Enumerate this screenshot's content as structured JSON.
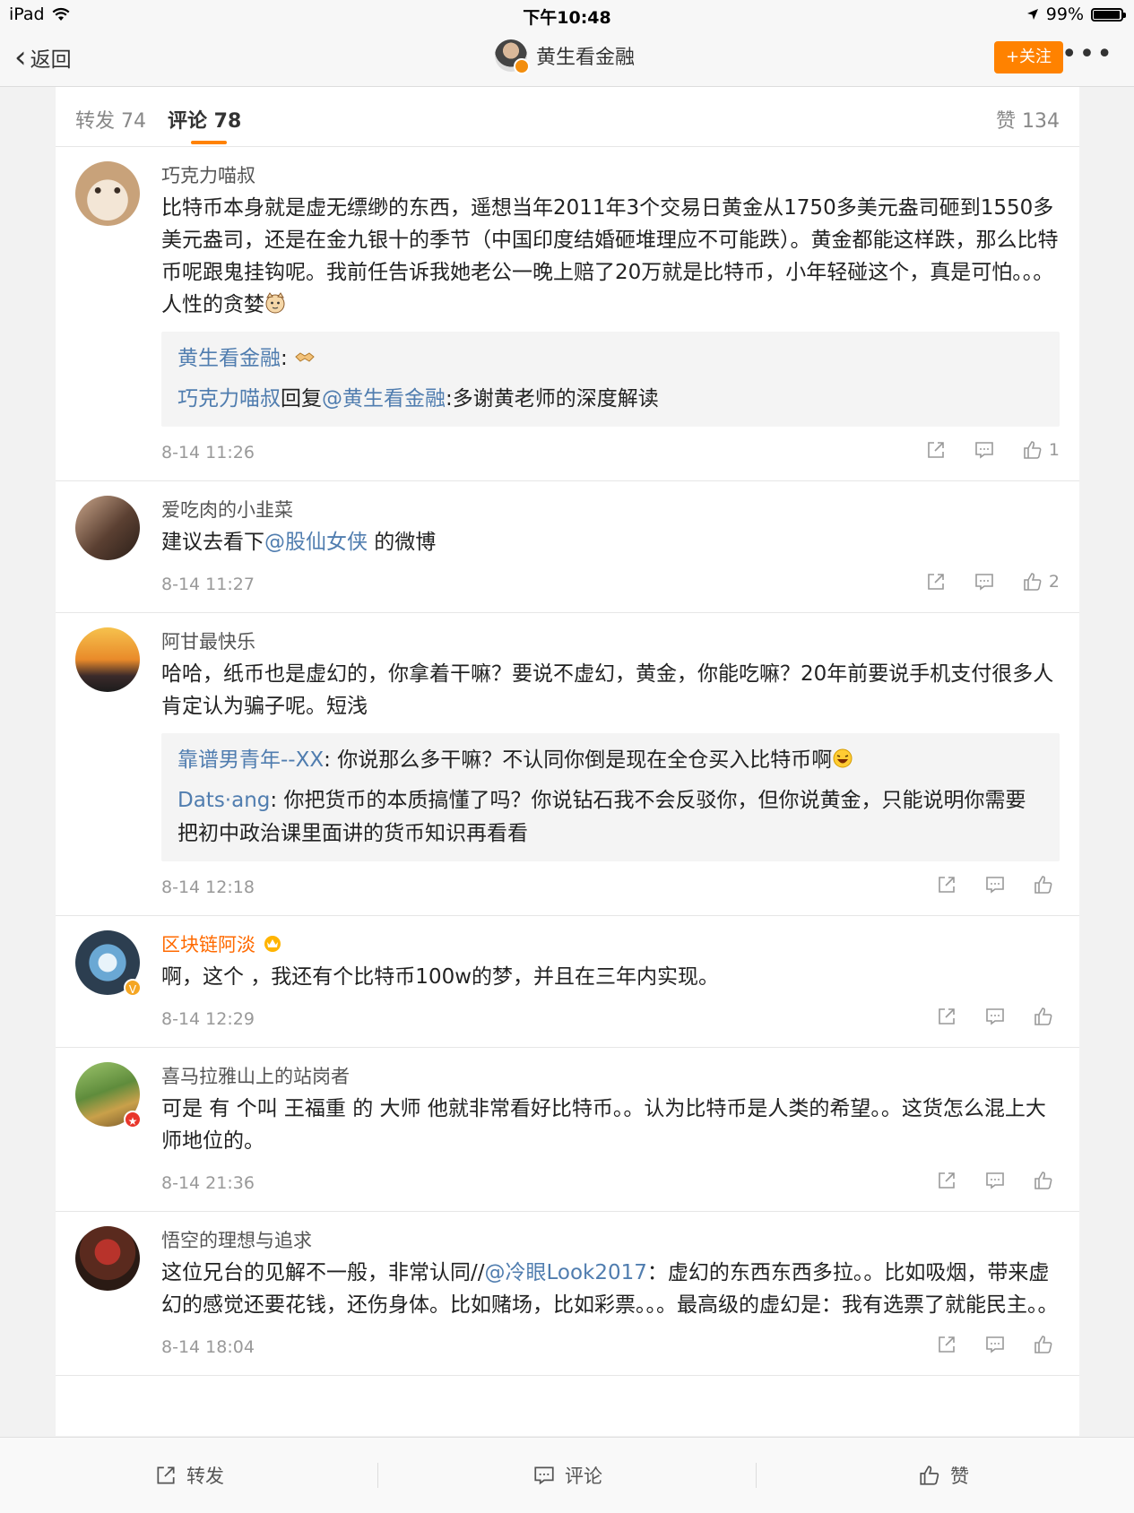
{
  "status": {
    "device": "iPad",
    "time": "下午10:48",
    "battery": "99%"
  },
  "nav": {
    "back": "返回",
    "title": "黄生看金融",
    "follow": "+关注",
    "more": "•••"
  },
  "tabs": {
    "repost": "转发 74",
    "comments": "评论 78",
    "likes": "赞 134"
  },
  "comments": [
    {
      "user": "巧克力喵叔",
      "text": "比特币本身就是虚无缥缈的东西，遥想当年2011年3个交易日黄金从1750多美元盎司砸到1550多美元盎司，还是在金九银十的季节（中国印度结婚砸堆理应不可能跌）。黄金都能这样跌，那么比特币呢跟鬼挂钩呢。我前任告诉我她老公一晚上赔了20万就是比特币，小年轻碰这个，真是可怕。。。人性的贪婪",
      "replies": [
        {
          "user": "黄生看金融",
          "sep": ":",
          "text": ""
        },
        {
          "user": "巧克力喵叔",
          "mid": "回复",
          "mention": "@黄生看金融",
          "sep": ":",
          "text": "多谢黄老师的深度解读"
        }
      ],
      "time": "8-14 11:26",
      "likes": "1"
    },
    {
      "user": "爱吃肉的小韭菜",
      "text_before": "建议去看下",
      "mention": "@股仙女侠",
      "text_after": " 的微博",
      "time": "8-14 11:27",
      "likes": "2"
    },
    {
      "user": "阿甘最快乐",
      "text": "哈哈，纸币也是虚幻的，你拿着干嘛？要说不虚幻，黄金，你能吃嘛？20年前要说手机支付很多人肯定认为骗子呢。短浅",
      "replies": [
        {
          "user": "靠谱男青年--XX",
          "sep": ": ",
          "text": "你说那么多干嘛？不认同你倒是现在全仓买入比特币啊"
        },
        {
          "user": "Dats·ang",
          "sep": ": ",
          "text": "你把货币的本质搞懂了吗？你说钻石我不会反驳你，但你说黄金，只能说明你需要把初中政治课里面讲的货币知识再看看"
        }
      ],
      "time": "8-14 12:18",
      "likes": ""
    },
    {
      "user": "区块链阿淡",
      "text": "啊，这个 ，我还有个比特币100w的梦，并且在三年内实现。",
      "time": "8-14 12:29",
      "likes": ""
    },
    {
      "user": "喜马拉雅山上的站岗者",
      "text": "可是 有 个叫 王福重  的 大师 他就非常看好比特币。。认为比特币是人类的希望。。这货怎么混上大师地位的。",
      "time": "8-14 21:36",
      "likes": ""
    },
    {
      "user": "悟空的理想与追求",
      "text_before": "这位兄台的见解不一般，非常认同//",
      "mention": "@冷眼Look2017",
      "text_after": "：虚幻的东西东西多拉。。比如吸烟，带来虚幻的感觉还要花钱，还伤身体。比如赌场，比如彩票。。。最高级的虚幻是：我有选票了就能民主。。",
      "time": "8-14 18:04",
      "likes": ""
    }
  ],
  "bottom": {
    "repost": "转发",
    "comment": "评论",
    "like": "赞"
  },
  "colors": {
    "accent": "#ff8200",
    "link": "#507daf",
    "vip_name": "#ff6a00"
  }
}
